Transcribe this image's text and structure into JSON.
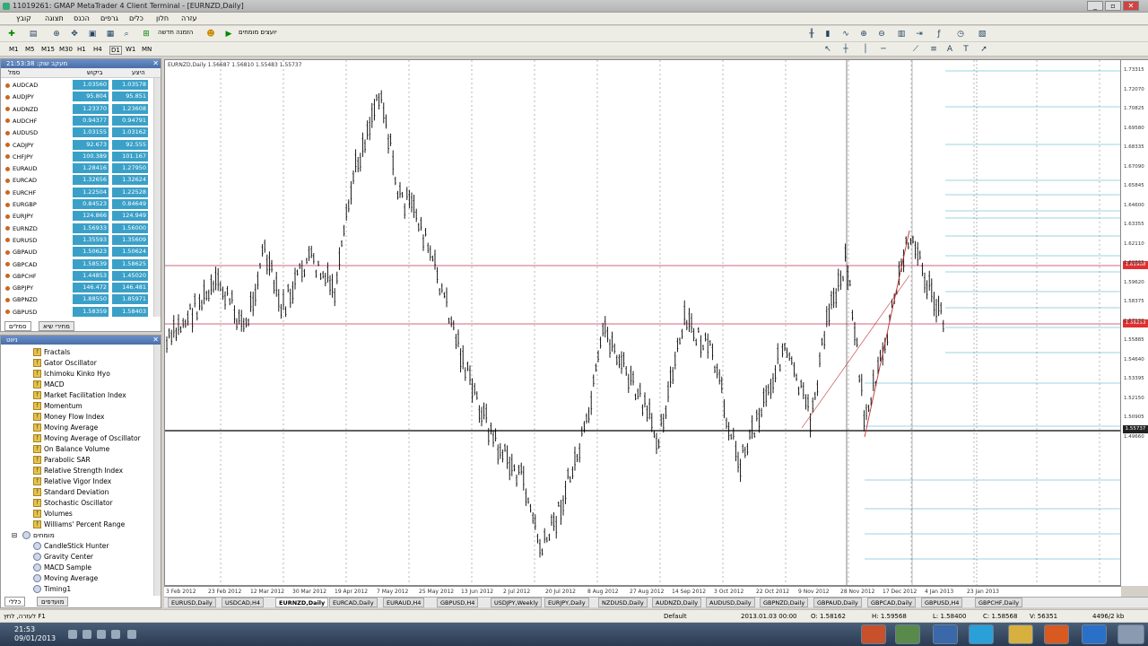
{
  "window": {
    "title": "11019261: GMAP MetaTrader 4 Client Terminal - [EURNZD,Daily]",
    "controls": [
      "_",
      "▫",
      "✕"
    ]
  },
  "menu": [
    "קובץ",
    "תצוגה",
    "הכנס",
    "גרפים",
    "כלים",
    "חלון",
    "עזרה"
  ],
  "toolbar": {
    "new_order": "הזמנה חדשה",
    "expert": "יועצים מומחים",
    "toolbar_icons": [
      "new-chart-icon",
      "profiles-icon",
      "zoom-icon",
      "navigator-icon",
      "terminal-icon",
      "strategy-tester-icon",
      "new-order-icon",
      "experts-icon"
    ],
    "chart_icons": [
      "bar-chart-icon",
      "candle-chart-icon",
      "line-chart-icon",
      "zoom-in-icon",
      "zoom-out-icon",
      "tile-icon",
      "autoscroll-icon",
      "shift-icon",
      "indicators-icon",
      "periods-icon",
      "templates-icon"
    ],
    "periods": [
      "M1",
      "M5",
      "M15",
      "M30",
      "H1",
      "H4",
      "D1",
      "W1",
      "MN"
    ]
  },
  "market_watch": {
    "title": "מעקב שוק: 21:53:38",
    "cols": [
      "סמל",
      "ביקוש",
      "היצע"
    ],
    "rows": [
      {
        "sym": "AUDCAD",
        "bid": "1.03560",
        "ask": "1.03578"
      },
      {
        "sym": "AUDJPY",
        "bid": "95.804",
        "ask": "95.851"
      },
      {
        "sym": "AUDNZD",
        "bid": "1.23370",
        "ask": "1.23608"
      },
      {
        "sym": "AUDCHF",
        "bid": "0.94377",
        "ask": "0.94791"
      },
      {
        "sym": "AUDUSD",
        "bid": "1.03155",
        "ask": "1.03162"
      },
      {
        "sym": "CADJPY",
        "bid": "92.673",
        "ask": "92.555"
      },
      {
        "sym": "CHFJPY",
        "bid": "100.389",
        "ask": "101.167"
      },
      {
        "sym": "EURAUD",
        "bid": "1.28416",
        "ask": "1.27950"
      },
      {
        "sym": "EURCAD",
        "bid": "1.32656",
        "ask": "1.32624"
      },
      {
        "sym": "EURCHF",
        "bid": "1.22504",
        "ask": "1.22528"
      },
      {
        "sym": "EURGBP",
        "bid": "0.84523",
        "ask": "0.84649"
      },
      {
        "sym": "EURJPY",
        "bid": "124.866",
        "ask": "124.949"
      },
      {
        "sym": "EURNZD",
        "bid": "1.56933",
        "ask": "1.56000"
      },
      {
        "sym": "EURUSD",
        "bid": "1.35593",
        "ask": "1.35609"
      },
      {
        "sym": "GBPAUD",
        "bid": "1.50623",
        "ask": "1.50624"
      },
      {
        "sym": "GBPCAD",
        "bid": "1.58539",
        "ask": "1.58625"
      },
      {
        "sym": "GBPCHF",
        "bid": "1.44853",
        "ask": "1.45020"
      },
      {
        "sym": "GBPJPY",
        "bid": "146.472",
        "ask": "146.481"
      },
      {
        "sym": "GBPNZD",
        "bid": "1.88550",
        "ask": "1.85971"
      },
      {
        "sym": "GBPUSD",
        "bid": "1.58359",
        "ask": "1.58403"
      }
    ],
    "tabs": [
      "סמלים",
      "מחירי שיא"
    ]
  },
  "navigator": {
    "title": "ניווט",
    "items": [
      "Fractals",
      "Gator Oscillator",
      "Ichimoku Kinko Hyo",
      "MACD",
      "Market Facilitation Index",
      "Momentum",
      "Money Flow Index",
      "Moving Average",
      "Moving Average of Oscillator",
      "On Balance Volume",
      "Parabolic SAR",
      "Relative Strength Index",
      "Relative Vigor Index",
      "Standard Deviation",
      "Stochastic Oscillator",
      "Volumes",
      "Williams' Percent Range"
    ],
    "experts_folder": "מומחים",
    "experts": [
      "CandleStick Hunter",
      "Gravity Center",
      "MACD Sample",
      "Moving Average",
      "Timing1"
    ],
    "tabs": [
      "כללי",
      "מועדפים"
    ]
  },
  "chart": {
    "label": "EURNZD,Daily  1.56687 1.56810 1.55483 1.55737",
    "price_labels": [
      "1.73315",
      "1.72070",
      "1.70825",
      "1.69580",
      "1.68335",
      "1.67090",
      "1.65845",
      "1.64600",
      "1.63355",
      "1.62110",
      "1.60865",
      "1.59620",
      "1.58375",
      "1.57130",
      "1.55885",
      "1.54640",
      "1.53395",
      "1.52150",
      "1.50905",
      "1.49660"
    ],
    "date_labels": [
      "3 Feb 2012",
      "23 Feb 2012",
      "12 Mar 2012",
      "30 Mar 2012",
      "19 Apr 2012",
      "7 May 2012",
      "25 May 2012",
      "13 Jun 2012",
      "2 Jul 2012",
      "20 Jul 2012",
      "8 Aug 2012",
      "27 Aug 2012",
      "14 Sep 2012",
      "3 Oct 2012",
      "22 Oct 2012",
      "9 Nov 2012",
      "28 Nov 2012",
      "17 Dec 2012",
      "4 Jan 2013",
      "23 Jan 2013"
    ],
    "current_price": "1.55737",
    "level_high": "1.61908",
    "level_mid": "1.59253",
    "bid_tag": "1.55737"
  },
  "chart_tabs": [
    "EURUSD,Daily",
    "USDCAD,H4",
    "EURNZD,Daily",
    "EURCAD,Daily",
    "EURAUD,H4",
    "GBPUSD,H4",
    "USDJPY,Weekly",
    "EURJPY,Daily",
    "NZDUSD,Daily",
    "AUDNZD,Daily",
    "AUDUSD,Daily",
    "GBPNZD,Daily",
    "GBPAUD,Daily",
    "GBPCAD,Daily",
    "GBPUSD,H4",
    "GBPCHF,Daily"
  ],
  "status": {
    "help": "לעזרה, לחץ F1",
    "profile": "Default",
    "datetime": "2013.01.03 00:00",
    "open": "O: 1.58162",
    "high": "H: 1.59568",
    "low": "L: 1.58400",
    "close": "C: 1.58568",
    "vol": "V: 56351",
    "kb": "4496/2 kb"
  },
  "taskbar": {
    "time": "21:53",
    "date": "09/01/2013"
  }
}
